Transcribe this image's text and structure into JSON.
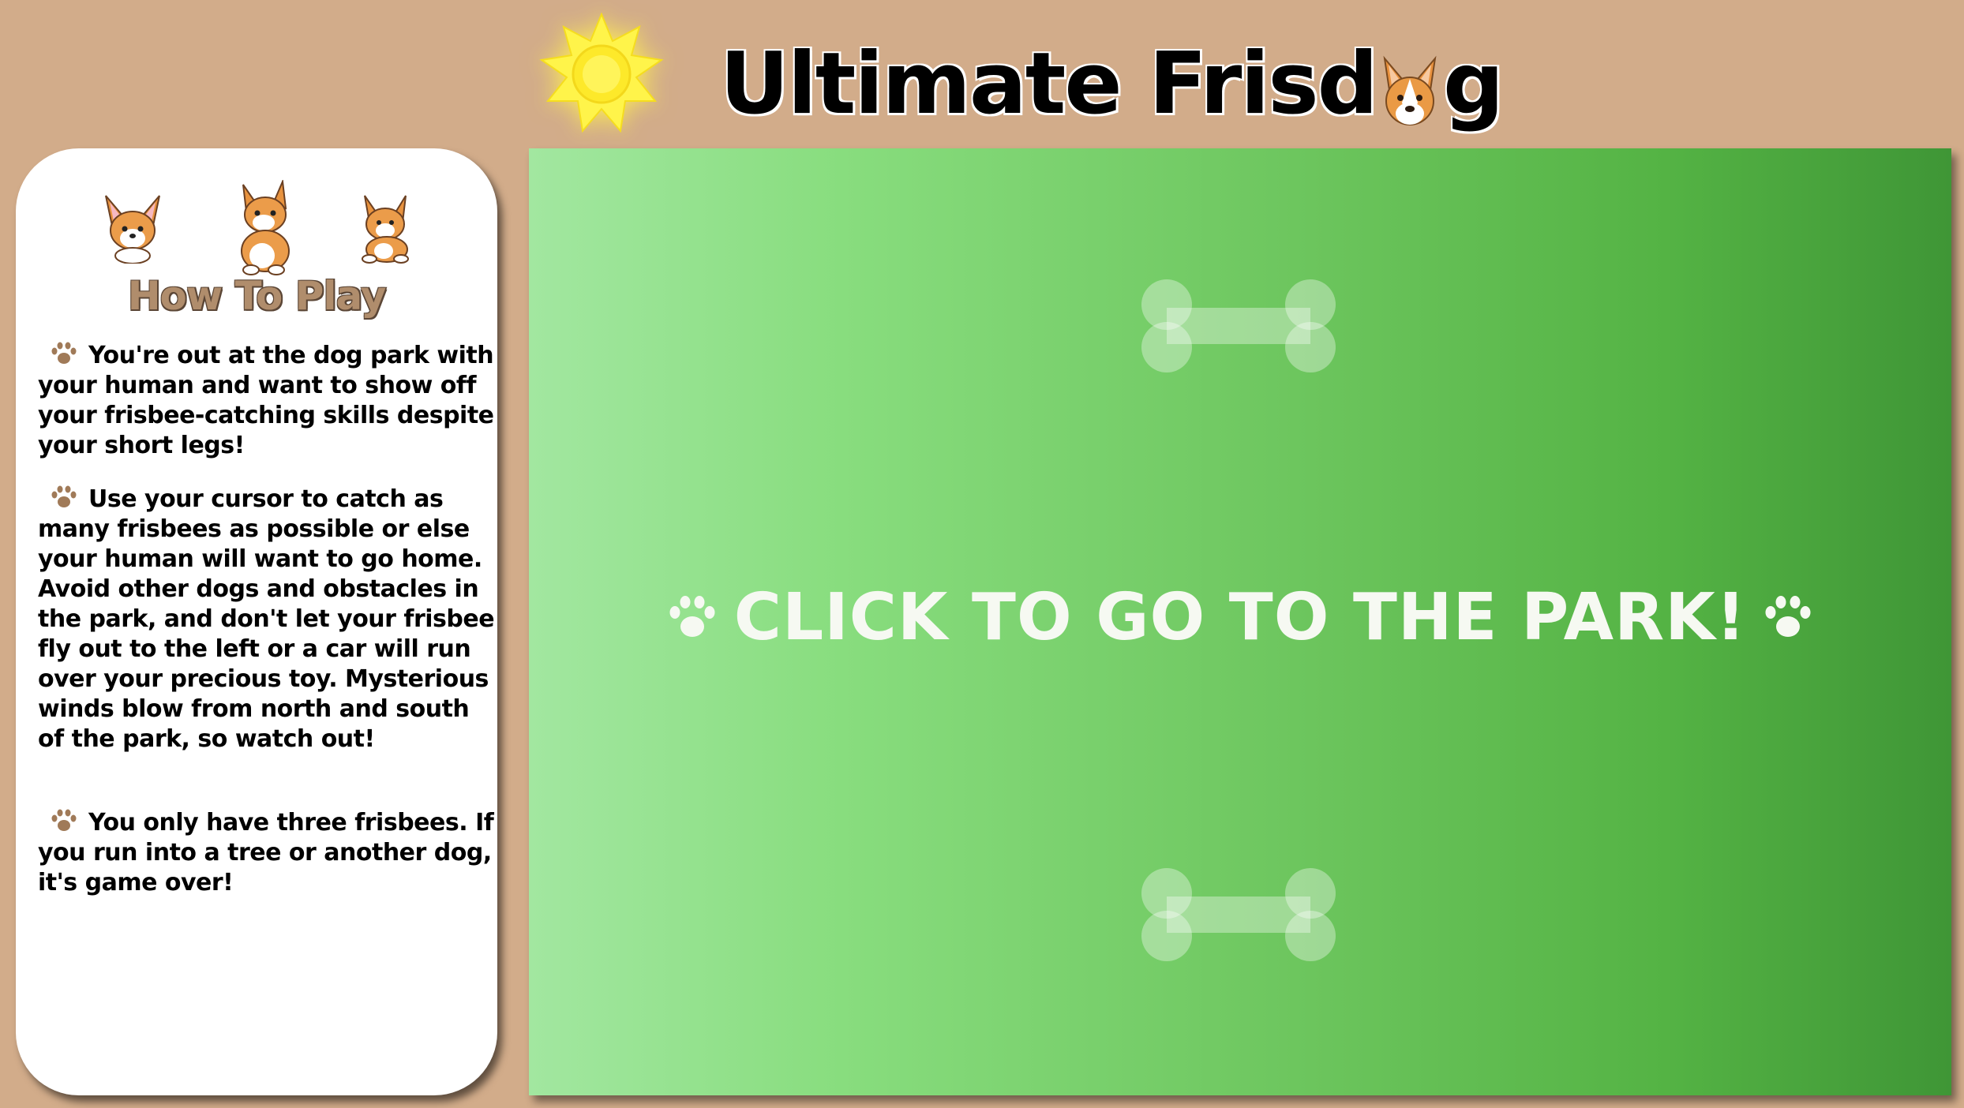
{
  "header": {
    "title_part1": "Ultimate Frisd",
    "title_part2": "g"
  },
  "instructions": {
    "heading": "How To Play",
    "paragraphs": [
      "You're out at the dog park with your human and want to show off your frisbee-catching skills despite your short legs!",
      "Use your cursor to catch as many frisbees as possible or else your human will want to go home. Avoid other dogs and obstacles in the park, and don't let your frisbee fly out to the left or a car will run over your precious toy. Mysterious winds blow from north and south of the park, so watch out!",
      "You only have three frisbees. If you run into a tree or another dog, it's game over!"
    ]
  },
  "park": {
    "cta_label": "CLICK TO GO TO THE PARK!"
  },
  "icons": [
    "sun-icon",
    "corgi-icon",
    "paw-icon",
    "bone-icon"
  ],
  "colors": {
    "background": "#d2ac8a",
    "panel": "#ffffff",
    "heading": "#b08d6c",
    "paw": "#a07a58",
    "park_light": "#a2e7a0",
    "park_dark": "#3f9636",
    "sun": "#fff44a",
    "cta_text": "#f6f9f2"
  }
}
